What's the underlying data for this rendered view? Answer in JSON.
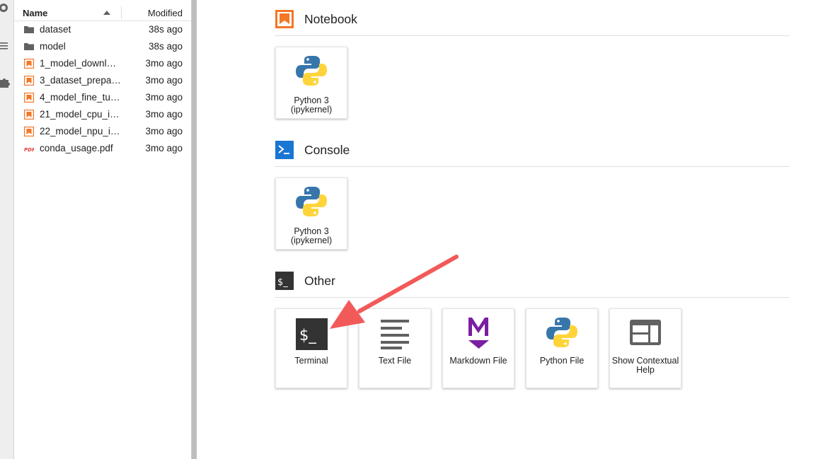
{
  "file_browser": {
    "columns": {
      "name": "Name",
      "modified": "Modified"
    },
    "files": [
      {
        "name": "dataset",
        "modified": "38s ago",
        "icon": "folder-icon"
      },
      {
        "name": "model",
        "modified": "38s ago",
        "icon": "folder-icon"
      },
      {
        "name": "1_model_downl…",
        "modified": "3mo ago",
        "icon": "notebook-icon"
      },
      {
        "name": "3_dataset_prepa…",
        "modified": "3mo ago",
        "icon": "notebook-icon"
      },
      {
        "name": "4_model_fine_tu…",
        "modified": "3mo ago",
        "icon": "notebook-icon"
      },
      {
        "name": "21_model_cpu_i…",
        "modified": "3mo ago",
        "icon": "notebook-icon"
      },
      {
        "name": "22_model_npu_i…",
        "modified": "3mo ago",
        "icon": "notebook-icon"
      },
      {
        "name": "conda_usage.pdf",
        "modified": "3mo ago",
        "icon": "pdf-icon"
      }
    ]
  },
  "launcher": {
    "notebook": {
      "title": "Notebook",
      "cards": [
        {
          "label": "Python 3 (ipykernel)"
        }
      ]
    },
    "console": {
      "title": "Console",
      "cards": [
        {
          "label": "Python 3 (ipykernel)"
        }
      ]
    },
    "other": {
      "title": "Other",
      "cards": [
        {
          "label": "Terminal"
        },
        {
          "label": "Text File"
        },
        {
          "label": "Markdown File"
        },
        {
          "label": "Python File"
        },
        {
          "label": "Show Contextual Help"
        }
      ]
    }
  },
  "colors": {
    "accent_orange": "#f37726",
    "console_blue": "#1976d2",
    "markdown_purple": "#7b1fa2",
    "annotation_arrow": "#f25a5a"
  }
}
